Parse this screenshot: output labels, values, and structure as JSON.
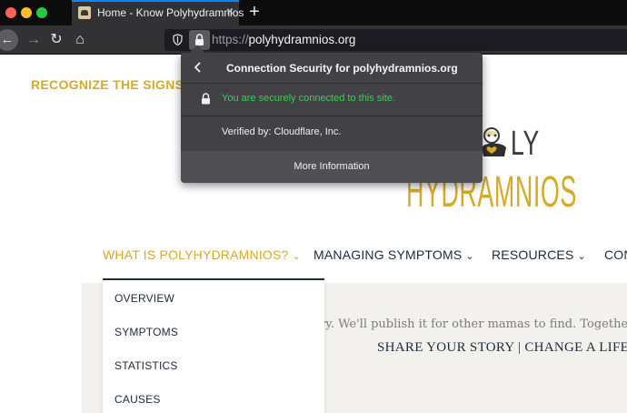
{
  "browser": {
    "tab_title": "Home - Know Polyhydramnios",
    "tab_close": "×",
    "new_tab": "+",
    "url_scheme": "https://",
    "url_host": "polyhydramnios.org",
    "nav_icons": {
      "back": "←",
      "forward": "→",
      "reload": "↻",
      "home": "⌂"
    }
  },
  "security_panel": {
    "title": "Connection Security for polyhydramnios.org",
    "status": "You are securely connected to this site.",
    "verified_by": "Verified by: Cloudflare, Inc.",
    "more_info": "More Information"
  },
  "page": {
    "tagline": "RECOGNIZE THE SIGNS.",
    "logo_line1": "LY",
    "logo_line2": "HYDRAMNIOS",
    "nav": [
      {
        "label": "WHAT IS POLYHYDRAMNIOS?",
        "caret": "⌄",
        "active": true
      },
      {
        "label": "MANAGING SYMPTOMS",
        "caret": "⌄",
        "active": false
      },
      {
        "label": "RESOURCES",
        "caret": "⌄",
        "active": false
      },
      {
        "label": "CON",
        "caret": "",
        "active": false
      }
    ],
    "submenu": [
      "OVERVIEW",
      "SYMPTOMS",
      "STATISTICS",
      "CAUSES"
    ],
    "hero_text": "ry. We'll publish it for other mamas to find. Together,",
    "hero_cta": "SHARE YOUR STORY | CHANGE A LIFE"
  },
  "colors": {
    "accent_gold": "#d5aa26",
    "navy": "#1d2a3a",
    "secure_green": "#34d058",
    "tab_highlight": "#0a84ff"
  }
}
